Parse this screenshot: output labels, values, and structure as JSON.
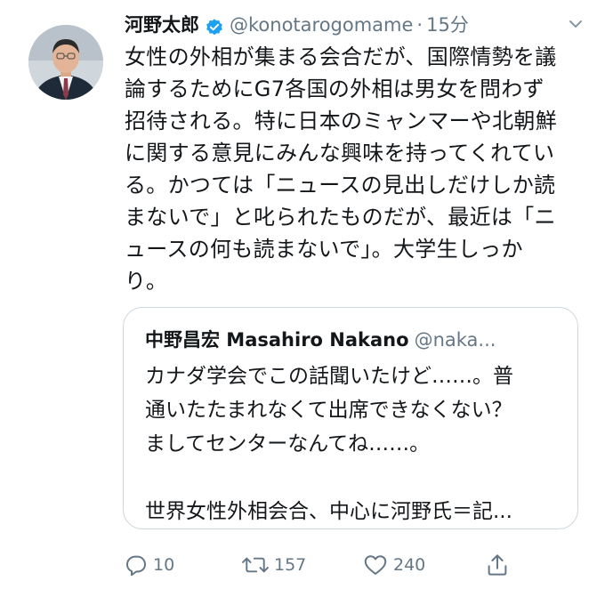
{
  "tweet": {
    "display_name": "河野太郎",
    "handle": "@konotarogomame",
    "separator": "·",
    "time": "15分",
    "lines": [
      "女性の外相が集まる会合だが、国際情勢を議",
      "論するためにG7各国の外相は男女を問わず",
      "招待される。特に日本のミャンマーや北朝鮮",
      "に関する意見にみんな興味を持ってくれてい",
      "る。かつては「ニュースの見出しだけしか読",
      "まないで」と叱られたものだが、最近は「ニ",
      "ュースの何も読まないで」。大学生しっか",
      "り。"
    ]
  },
  "quote": {
    "display_name": "中野昌宏 Masahiro Nakano",
    "handle": "@naka...",
    "lines": [
      "カナダ学会でこの話聞いたけど……。普",
      "通いたたまれなくて出席できなくない？",
      "ましてセンターなんてね……。",
      "",
      "世界女性外相会合、中心に河野氏＝記..."
    ]
  },
  "actions": {
    "reply_count": "10",
    "retweet_count": "157",
    "like_count": "240"
  },
  "icons": {
    "verified": "verified-badge-icon",
    "menu": "chevron-down-icon",
    "reply": "reply-icon",
    "retweet": "retweet-icon",
    "like": "heart-icon",
    "share": "share-icon"
  },
  "colors": {
    "text": "#14171a",
    "secondary": "#657786",
    "verified": "#1da1f2",
    "border": "#ccd6dd"
  }
}
